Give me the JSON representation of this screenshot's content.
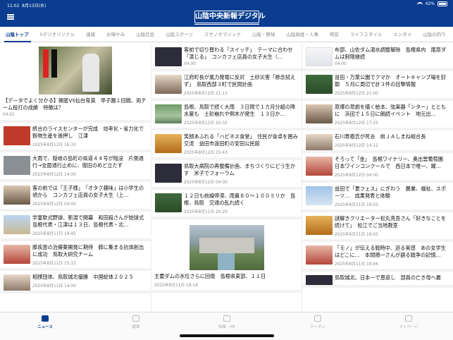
{
  "status": {
    "time": "11:02",
    "date": "8月13日(水)",
    "battery": "42%"
  },
  "header": {
    "title": "山陰中央新報デジタル"
  },
  "tabs": [
    "山陰トップ",
    "Sデジオリジナル",
    "速報",
    "お悔やみ",
    "山陰社会",
    "山陰スポーツ",
    "スサノオマジック",
    "山陰・野球",
    "山陰政経・人事",
    "明窓",
    "ライフスタイル",
    "エンタメ",
    "山陰の釣り"
  ],
  "col1": {
    "hero": {
      "title": "【データでよく分かる】開星VS仙台育英　甲子園１回戦、両チーム投打の成績　特徴は？",
      "date": "04:01"
    },
    "items": [
      {
        "title": "統合のライスセンターが完成　効率化・省力化で穀物生産を後押し　江津",
        "date": "2025年8月12日 16:33",
        "thumb": "t-rug"
      },
      {
        "title": "大雨で、隠岐の島町の県道４４号が陥没　片側通行→全面通行止めに、復旧のめど立たず",
        "date": "2025年8月12日 14:00",
        "thumb": "t-gray"
      },
      {
        "title": "客の前では「王子様」　「オタク趣味」は小学生の頃から　コンカフェ店員の女子大生（上…",
        "date": "2025年8月12日 04:00",
        "thumb": "t-people"
      },
      {
        "title": "学童軟式野球、新潟で開幕　和田殺さんが始球式　島根代表・江津は１３日、島根代表・北…",
        "date": "2025年8月11日 19:45",
        "thumb": "t-field"
      },
      {
        "title": "膵疾患の治療薬開発に期待　膵に集まる抗体創出に成功　鳥取大研究チーム",
        "date": "2025年8月11日 15:15",
        "thumb": "t-red"
      },
      {
        "title": "相撲団体、鳥取城北優勝　中国総体２０２５",
        "date": "2025年8月11日 14:00",
        "thumb": "t-man"
      }
    ]
  },
  "col2": {
    "items": [
      {
        "title": "客前で切り替わる「スイッチ」　テーマに合わせ「演じる」　コンカフェ店員の女子大生（…",
        "date": "04:00",
        "thumb": "t-dark"
      },
      {
        "title": "江府町長が風力発電に反対　土砂災害「懸念拭えず」　鳥取西部３町で民間計画",
        "date": "2025年8月12日 21:13",
        "thumb": "t-man"
      },
      {
        "title": "島根、鳥取で続く大雨　３日間で１カ月分超の降水量も　土砂崩れや倒木が発生　１３日か…",
        "date": "2025年8月12日 20:32",
        "thumb": "t-river"
      },
      {
        "title": "笑顔あふれる「ハピネス食堂」　住民が食卓を囲み交流　益田市遠田町の安田公民館",
        "date": "2025年8月12日 15:43",
        "thumb": "t-food"
      },
      {
        "title": "鳥取大病院の再整備計画、まちづくりにどう生かす　米子でフォーラム",
        "date": "2025年8月12日 04:00",
        "thumb": "t-dark"
      },
      {
        "title": "１２日も前線停滞、雨量８０～１００ミリか　島根、鳥取　交通の乱れ続く",
        "date": "2025年8月11日 20:20",
        "thumb": "t-forest"
      }
    ],
    "feature": {
      "title": "主要ダムの水位さらに回復　島根県東部、１１日",
      "date": "2025年8月11日 19:14"
    }
  },
  "col3": {
    "items": [
      {
        "title": "布部、山佐ダム渇水調整解除　島根県内　尾原ダムは制限継続",
        "date": "04:00",
        "thumb": "t-doc"
      },
      {
        "title": "益田・万葉公園でクマか　オートキャンプ場を封鎖　５月に周辺で計３件の目撃情報",
        "date": "2025年8月12日 21:00",
        "thumb": "t-forest"
      },
      {
        "title": "原爆の悲劇を描く絵本、弦楽器「シター」とともに　浜田で１５日に朗読イベント　地元出…",
        "date": "2025年8月12日 17:25",
        "thumb": "t-people"
      },
      {
        "title": "石川寿樹氏が死去　前ＪＡしまね組合長",
        "date": "2025年8月12日 14:12",
        "thumb": "t-man"
      },
      {
        "title": "そろって「金」　島根ワイナリー、奥出雲葡萄園　日本ワインコンクールで　西日本で唯一、躍…",
        "date": "2025年8月12日 04:00",
        "thumb": "t-red"
      },
      {
        "title": "益田で「夏フェス」にぎわう　農業、福祉、スポーツ…　成果発表と体験",
        "date": "2025年8月11日 19:53",
        "thumb": "t-sky"
      },
      {
        "title": "謎解きクリエーター松丸亮吾さん「好きなことを続けて」　松江でご当地教室",
        "date": "2025年8月11日 19:05",
        "thumb": "t-food"
      },
      {
        "title": "「モノ」が伝える戦時中、迫る実感　あの女学生はどこに…　本間順一さんが語る戦争の記憶…",
        "date": "2025年8月11日 18:46",
        "thumb": "t-red"
      },
      {
        "title": "鳥取城北、日本一で恩返し　部員の亡き母へ最",
        "date": "",
        "thumb": "t-dark"
      }
    ]
  },
  "bottom_tabs": [
    {
      "label": "ニュース",
      "active": true
    },
    {
      "label": "紙面",
      "active": false
    },
    {
      "label": "特集・PR",
      "active": false
    },
    {
      "label": "クーポン",
      "active": false
    },
    {
      "label": "マイページ",
      "active": false
    }
  ]
}
